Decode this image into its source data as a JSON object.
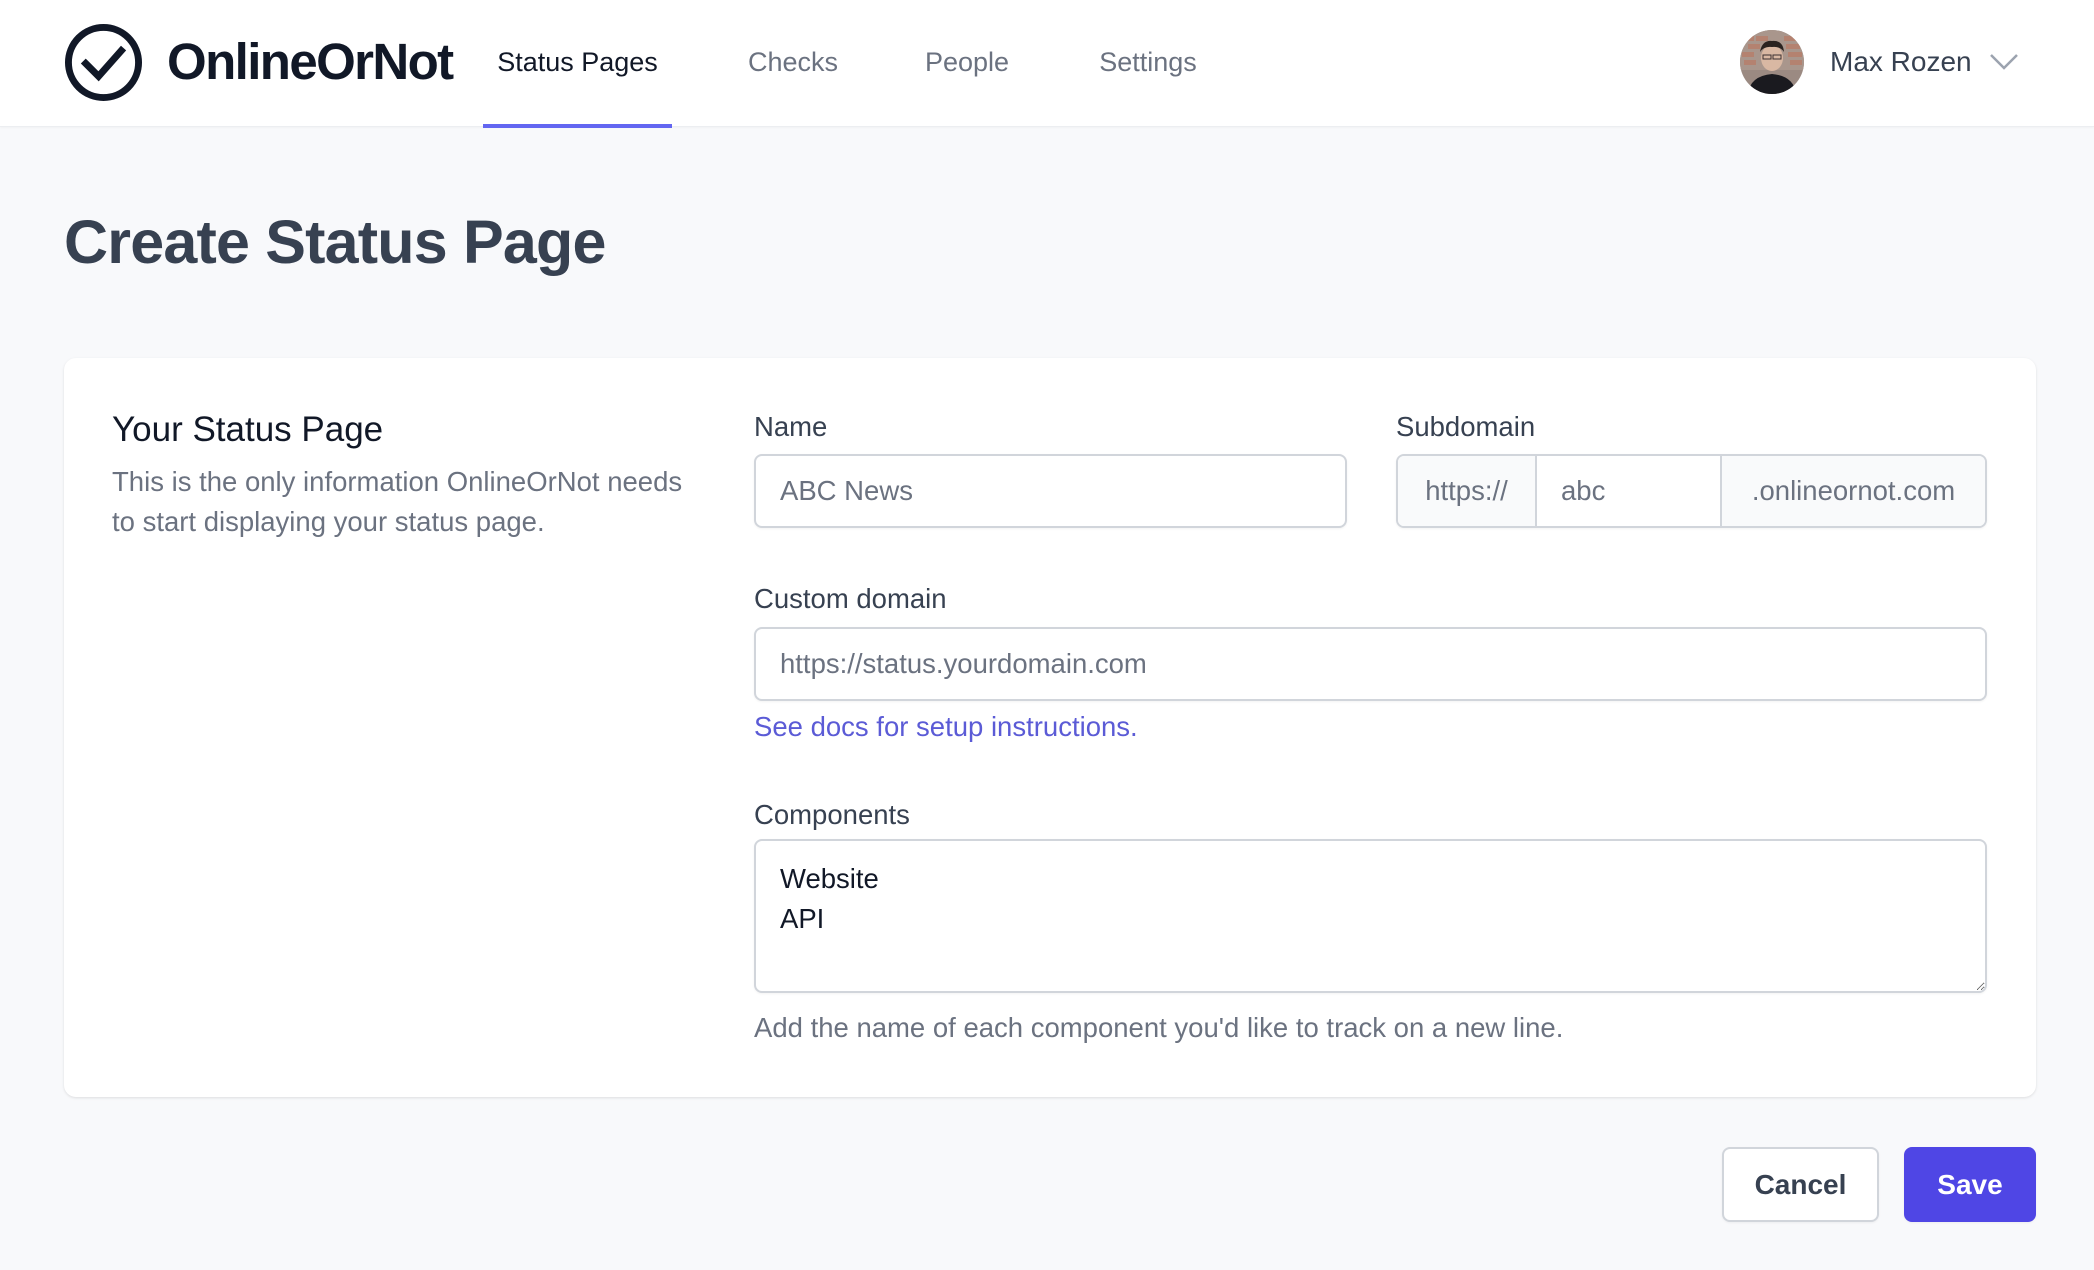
{
  "app": {
    "brand_name": "OnlineOrNot",
    "accent_color": "#6366f1",
    "primary_button_color": "#4f46e5"
  },
  "nav": {
    "items": [
      {
        "label": "Status Pages",
        "active": true
      },
      {
        "label": "Checks",
        "active": false
      },
      {
        "label": "People",
        "active": false
      },
      {
        "label": "Settings",
        "active": false
      }
    ]
  },
  "user": {
    "name": "Max Rozen",
    "avatar_icon": "user-photo",
    "menu_icon": "chevron-down-icon"
  },
  "page": {
    "title": "Create Status Page"
  },
  "form": {
    "section_title": "Your Status Page",
    "section_description": "This is the only information OnlineOrNot needs to start displaying your status page.",
    "name": {
      "label": "Name",
      "value": "",
      "placeholder": "ABC News"
    },
    "subdomain": {
      "label": "Subdomain",
      "prefix": "https://",
      "value": "",
      "placeholder": "abc",
      "suffix": ".onlineornot.com"
    },
    "custom_domain": {
      "label": "Custom domain",
      "value": "",
      "placeholder": "https://status.yourdomain.com",
      "docs_link": "See docs for setup instructions."
    },
    "components": {
      "label": "Components",
      "value": "Website\nAPI",
      "help_text": "Add the name of each component you'd like to track on a new line."
    }
  },
  "actions": {
    "cancel_label": "Cancel",
    "save_label": "Save"
  }
}
